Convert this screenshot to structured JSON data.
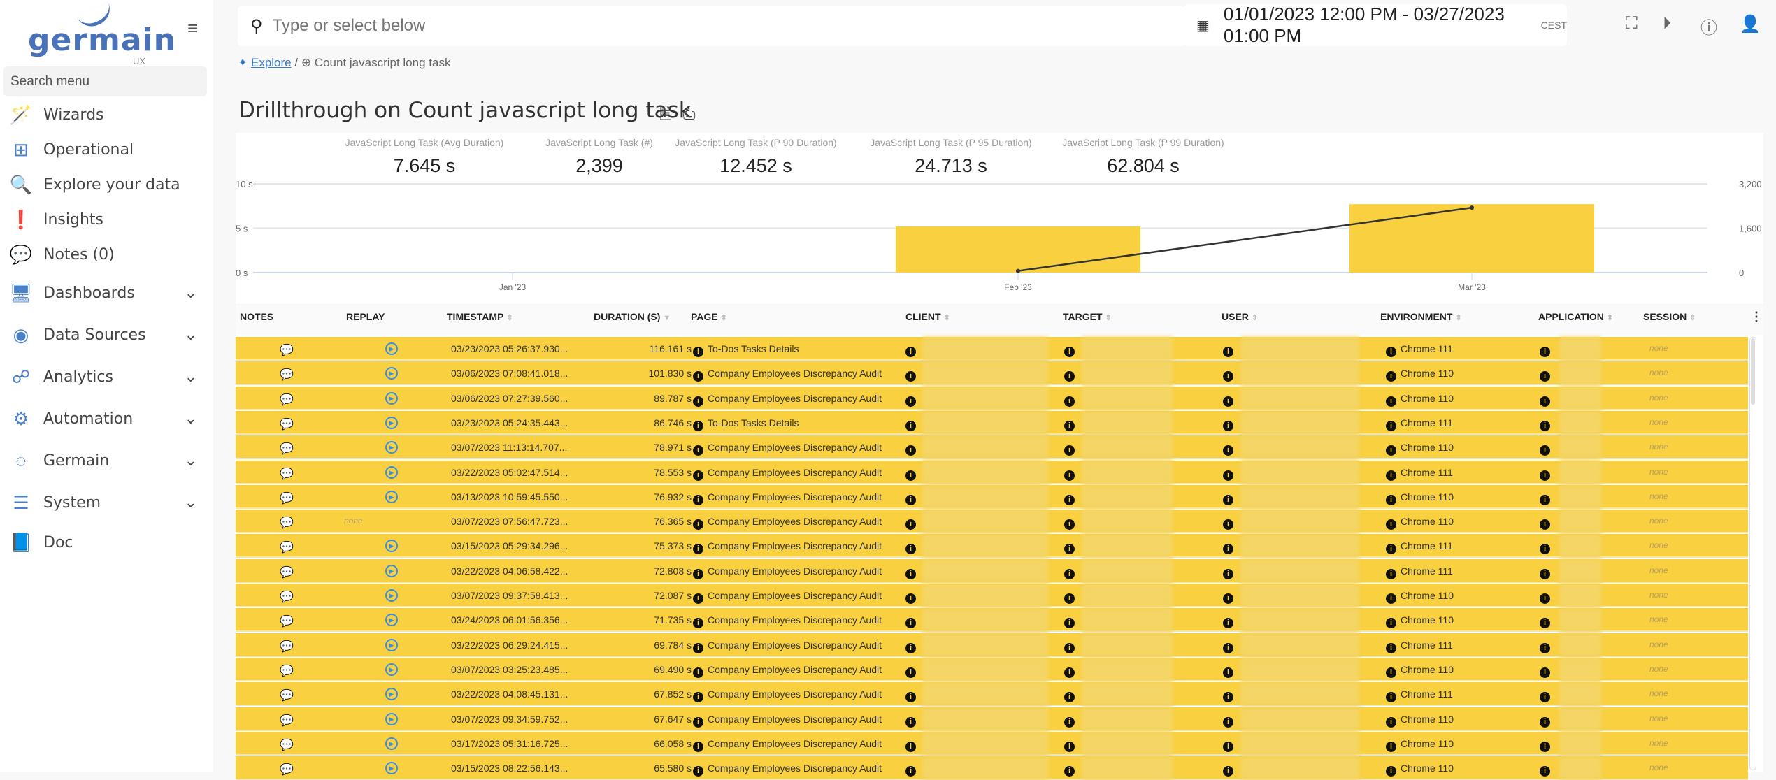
{
  "sidebar": {
    "logo": "germain",
    "logo_sub": "UX",
    "search_placeholder": "Search menu",
    "items": [
      {
        "label": "Wizards",
        "icon": "magic-wand-icon",
        "expandable": false
      },
      {
        "label": "Operational",
        "icon": "sitemap-icon",
        "expandable": false
      },
      {
        "label": "Explore your data",
        "icon": "search-icon",
        "expandable": false
      },
      {
        "label": "Insights",
        "icon": "exclamation-icon",
        "expandable": false
      },
      {
        "label": "Notes (0)",
        "icon": "comments-icon",
        "expandable": false
      },
      {
        "label": "Dashboards",
        "icon": "monitor-chart-icon",
        "expandable": true
      },
      {
        "label": "Data Sources",
        "icon": "database-icon",
        "expandable": true
      },
      {
        "label": "Analytics",
        "icon": "analytics-icon",
        "expandable": true
      },
      {
        "label": "Automation",
        "icon": "gear-icon",
        "expandable": true
      },
      {
        "label": "Germain",
        "icon": "dotted-circle-icon",
        "expandable": true
      },
      {
        "label": "System",
        "icon": "sliders-icon",
        "expandable": true
      },
      {
        "label": "Doc",
        "icon": "book-icon",
        "expandable": false
      }
    ]
  },
  "header": {
    "search_placeholder": "Type or select below",
    "date_range": "01/01/2023 12:00 PM - 03/27/2023 01:00 PM",
    "timezone": "CEST"
  },
  "breadcrumb": {
    "root": "Explore",
    "current": "Count javascript long task"
  },
  "page_title": "Drillthrough on Count javascript long task",
  "kpis": [
    {
      "label": "JavaScript Long Task (Avg Duration)",
      "value": "7.645 s"
    },
    {
      "label": "JavaScript Long Task (#)",
      "value": "2,399"
    },
    {
      "label": "JavaScript Long Task (P 90 Duration)",
      "value": "12.452 s"
    },
    {
      "label": "JavaScript Long Task (P 95 Duration)",
      "value": "24.713 s"
    },
    {
      "label": "JavaScript Long Task (P 99 Duration)",
      "value": "62.804 s"
    }
  ],
  "chart_data": {
    "type": "bar",
    "categories": [
      "Jan '23",
      "Feb '23",
      "Mar '23"
    ],
    "series": [
      {
        "type": "bar",
        "axis": "left",
        "values": [
          0,
          5.2,
          7.7
        ],
        "color": "#f8d040"
      },
      {
        "type": "line",
        "axis": "right",
        "values": [
          null,
          60,
          2339
        ],
        "color": "#333333"
      }
    ],
    "y_left": {
      "ticks": [
        "0 s",
        "5 s",
        "10 s"
      ],
      "range": [
        0,
        10
      ]
    },
    "y_right": {
      "ticks": [
        "0",
        "1,600",
        "3,200"
      ],
      "range": [
        0,
        3200
      ]
    },
    "grid": true
  },
  "table": {
    "columns": [
      "NOTES",
      "REPLAY",
      "TIMESTAMP",
      "DURATION (S)",
      "PAGE",
      "CLIENT",
      "TARGET",
      "USER",
      "ENVIRONMENT",
      "APPLICATION",
      "SESSION"
    ],
    "none_label": "none",
    "rows": [
      {
        "replay": true,
        "timestamp": "03/23/2023 05:26:37.930...",
        "duration": "116.161 s",
        "page": "To-Dos Tasks Details",
        "environment": "Chrome 111"
      },
      {
        "replay": true,
        "timestamp": "03/06/2023 07:08:41.018...",
        "duration": "101.830 s",
        "page": "Company Employees Discrepancy Audit",
        "environment": "Chrome 110"
      },
      {
        "replay": true,
        "timestamp": "03/06/2023 07:27:39.560...",
        "duration": "89.787 s",
        "page": "Company Employees Discrepancy Audit",
        "environment": "Chrome 110"
      },
      {
        "replay": true,
        "timestamp": "03/23/2023 05:24:35.443...",
        "duration": "86.746 s",
        "page": "To-Dos Tasks Details",
        "environment": "Chrome 111"
      },
      {
        "replay": true,
        "timestamp": "03/07/2023 11:13:14.707...",
        "duration": "78.971 s",
        "page": "Company Employees Discrepancy Audit",
        "environment": "Chrome 110"
      },
      {
        "replay": true,
        "timestamp": "03/22/2023 05:02:47.514...",
        "duration": "78.553 s",
        "page": "Company Employees Discrepancy Audit",
        "environment": "Chrome 111"
      },
      {
        "replay": true,
        "timestamp": "03/13/2023 10:59:45.550...",
        "duration": "76.932 s",
        "page": "Company Employees Discrepancy Audit",
        "environment": "Chrome 110"
      },
      {
        "replay": false,
        "timestamp": "03/07/2023 07:56:47.723...",
        "duration": "76.365 s",
        "page": "Company Employees Discrepancy Audit",
        "environment": "Chrome 110"
      },
      {
        "replay": true,
        "timestamp": "03/15/2023 05:29:34.296...",
        "duration": "75.373 s",
        "page": "Company Employees Discrepancy Audit",
        "environment": "Chrome 111"
      },
      {
        "replay": true,
        "timestamp": "03/22/2023 04:06:58.422...",
        "duration": "72.808 s",
        "page": "Company Employees Discrepancy Audit",
        "environment": "Chrome 111"
      },
      {
        "replay": true,
        "timestamp": "03/07/2023 09:37:58.413...",
        "duration": "72.087 s",
        "page": "Company Employees Discrepancy Audit",
        "environment": "Chrome 110"
      },
      {
        "replay": true,
        "timestamp": "03/24/2023 06:01:56.356...",
        "duration": "71.735 s",
        "page": "Company Employees Discrepancy Audit",
        "environment": "Chrome 110"
      },
      {
        "replay": true,
        "timestamp": "03/22/2023 06:29:24.415...",
        "duration": "69.784 s",
        "page": "Company Employees Discrepancy Audit",
        "environment": "Chrome 111"
      },
      {
        "replay": true,
        "timestamp": "03/07/2023 03:25:23.485...",
        "duration": "69.490 s",
        "page": "Company Employees Discrepancy Audit",
        "environment": "Chrome 110"
      },
      {
        "replay": true,
        "timestamp": "03/22/2023 04:08:45.131...",
        "duration": "67.852 s",
        "page": "Company Employees Discrepancy Audit",
        "environment": "Chrome 111"
      },
      {
        "replay": true,
        "timestamp": "03/07/2023 09:34:59.752...",
        "duration": "67.647 s",
        "page": "Company Employees Discrepancy Audit",
        "environment": "Chrome 110"
      },
      {
        "replay": true,
        "timestamp": "03/17/2023 05:31:16.725...",
        "duration": "66.058 s",
        "page": "Company Employees Discrepancy Audit",
        "environment": "Chrome 110"
      },
      {
        "replay": true,
        "timestamp": "03/15/2023 08:22:56.143...",
        "duration": "65.580 s",
        "page": "Company Employees Discrepancy Audit",
        "environment": "Chrome 110"
      }
    ]
  }
}
